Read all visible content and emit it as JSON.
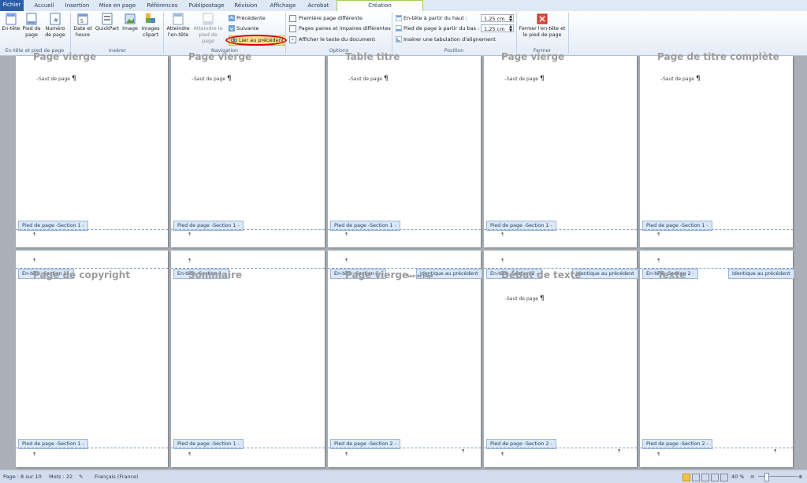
{
  "tabs": [
    "Fichier",
    "Accueil",
    "Insertion",
    "Mise en page",
    "Références",
    "Publipostage",
    "Révision",
    "Affichage",
    "Acrobat",
    "Création"
  ],
  "ribbon": {
    "hf_group": {
      "label": "En-tête et pied de page",
      "buttons": [
        "En-tête",
        "Pied de page",
        "Numéro de page"
      ]
    },
    "insert_group": {
      "label": "Insérer",
      "buttons": [
        "Date et heure",
        "QuickPart",
        "Image",
        "Images clipart"
      ]
    },
    "nav_group": {
      "label": "Navigation",
      "big1": "Atteindre l'en-tête",
      "big2": "Atteindre le pied de page",
      "prev": "Précédente",
      "next": "Suivante",
      "link": "Lier au précédent"
    },
    "options_group": {
      "label": "Options",
      "first": "Première page différente",
      "oddeven": "Pages paires et impaires différentes",
      "showtext": "Afficher le texte du document",
      "showtext_checked": true
    },
    "position_group": {
      "label": "Position",
      "header_top": "En-tête à partir du haut :",
      "header_top_val": "1,25 cm",
      "footer_bottom": "Pied de page à partir du bas :",
      "footer_bottom_val": "1,25 cm",
      "align_tab": "Insérer une tabulation d'alignement"
    },
    "close_group": {
      "label": "Fermer",
      "button": "Fermer l'en-tête et le pied de page"
    }
  },
  "doc": {
    "row1": [
      {
        "title": "Page vierge",
        "break": "Saut de page",
        "footer": "Pied de page -Section 1 -"
      },
      {
        "title": "Page vierge",
        "break": "Saut de page",
        "footer": "Pied de page -Section 1 -"
      },
      {
        "title": "Table titre",
        "break": "Saut de page",
        "footer": "Pied de page -Section 1 -"
      },
      {
        "title": "Page vierge",
        "break": "Saut de page",
        "footer": "Pied de page -Section 1 -"
      },
      {
        "title": "Page de titre complète",
        "break": "Saut de page",
        "footer": "Pied de page -Section 1 -"
      }
    ],
    "row2": [
      {
        "title": "Page de copyright",
        "header": "En-tête -Section 1 -",
        "same": "",
        "break": "",
        "footer": "Pied de page -Section 1 -"
      },
      {
        "title": "Sommaire",
        "header": "En-tête -Section 1 -",
        "same": "",
        "break": "",
        "footer": "Pied de page -Section 1 -"
      },
      {
        "title": "Page vierge",
        "header": "En-tête -Section 2 -",
        "same": "Identique au précédent",
        "break": "Saut de page",
        "footer": "Pied de page -Section 2 -"
      },
      {
        "title": "Début de texte",
        "header": "En-tête -Section 2 -",
        "same": "Identique au précédent",
        "break": "Saut de page",
        "footer": "Pied de page -Section 2 -"
      },
      {
        "title": "Texte",
        "header": "En-tête -Section 2 -",
        "same": "Identique au précédent",
        "break": "",
        "footer": "Pied de page -Section 2 -"
      }
    ]
  },
  "status": {
    "page": "Page : 8 sur 10",
    "words": "Mots : 22",
    "lang": "Français (France)",
    "zoom": "40 %"
  }
}
